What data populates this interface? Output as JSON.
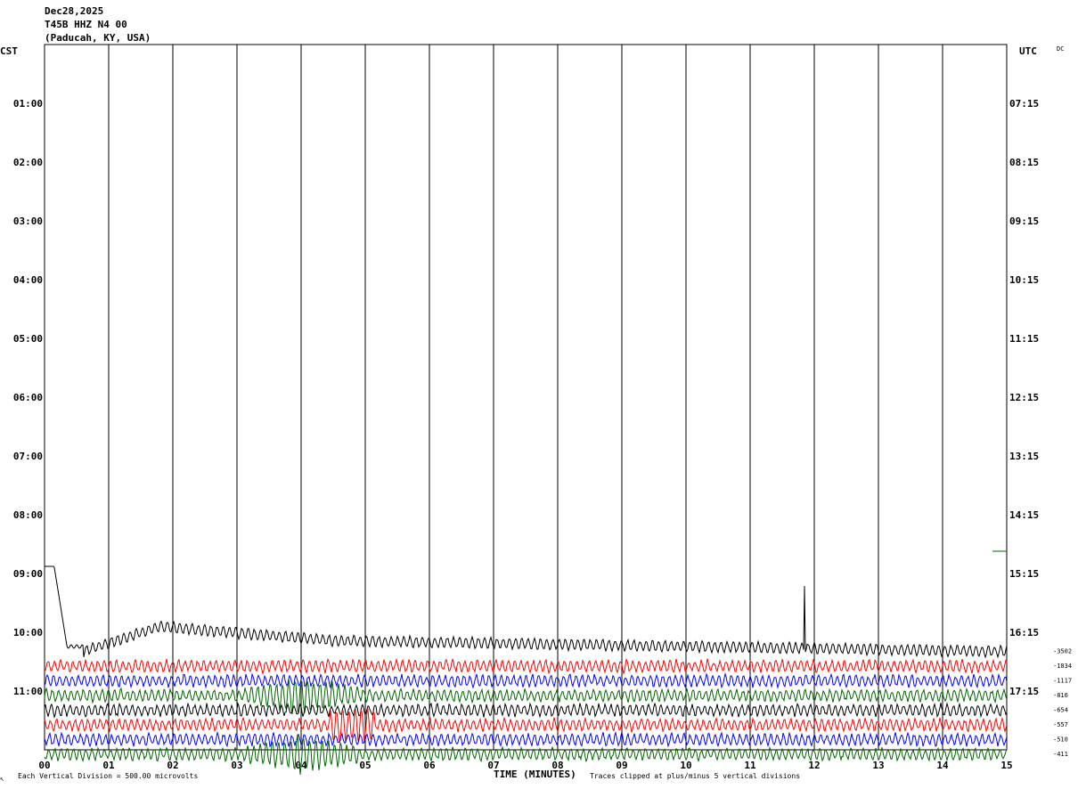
{
  "header": {
    "date": "Dec28,2025",
    "station": "T45B HHZ N4 00",
    "location": "(Paducah, KY, USA)"
  },
  "left_axis_label": "CST",
  "right_axis_label": "UTC",
  "dc_label": "DC",
  "corner_mark": "↖",
  "footer": {
    "scale_note": "Each Vertical Division =  500.00 microvolts",
    "clip_note": "Traces clipped at plus/minus 5 vertical divisions"
  },
  "colors": {
    "black": "#000000",
    "red": "#ff0000",
    "blue": "#0000ff",
    "green": "#006400",
    "grid": "#000000"
  },
  "chart_data": {
    "type": "line",
    "title": "",
    "xlabel": "TIME (MINUTES)",
    "ylabel": "",
    "x_ticks": [
      "00",
      "01",
      "02",
      "03",
      "04",
      "05",
      "06",
      "07",
      "08",
      "09",
      "10",
      "11",
      "12",
      "13",
      "14",
      "15"
    ],
    "xlim": [
      0,
      15
    ],
    "y_left_ticks": [
      "01:00",
      "02:00",
      "03:00",
      "04:00",
      "05:00",
      "06:00",
      "07:00",
      "08:00",
      "09:00",
      "10:00",
      "11:00"
    ],
    "y_right_ticks": [
      "07:15",
      "08:15",
      "09:15",
      "10:15",
      "11:15",
      "12:15",
      "13:15",
      "14:15",
      "15:15",
      "16:15",
      "17:15"
    ],
    "grid": true,
    "traces": [
      {
        "color": "black",
        "offset": "-3502",
        "row": 10.25
      },
      {
        "color": "red",
        "offset": "-1834",
        "row": 10.5
      },
      {
        "color": "blue",
        "offset": "-1117",
        "row": 10.75
      },
      {
        "color": "green",
        "offset": "-816",
        "row": 11.0
      },
      {
        "color": "black",
        "offset": "-654",
        "row": 11.25
      },
      {
        "color": "red",
        "offset": "-557",
        "row": 11.5
      },
      {
        "color": "blue",
        "offset": "-510",
        "row": 11.75
      },
      {
        "color": "green",
        "offset": "-411",
        "row": 12.0
      }
    ],
    "events": [
      {
        "minute": 4.0,
        "note": "burst on green traces"
      },
      {
        "minute": 4.8,
        "note": "burst on red trace"
      },
      {
        "minute": 11.85,
        "note": "spike on black trace"
      }
    ]
  }
}
